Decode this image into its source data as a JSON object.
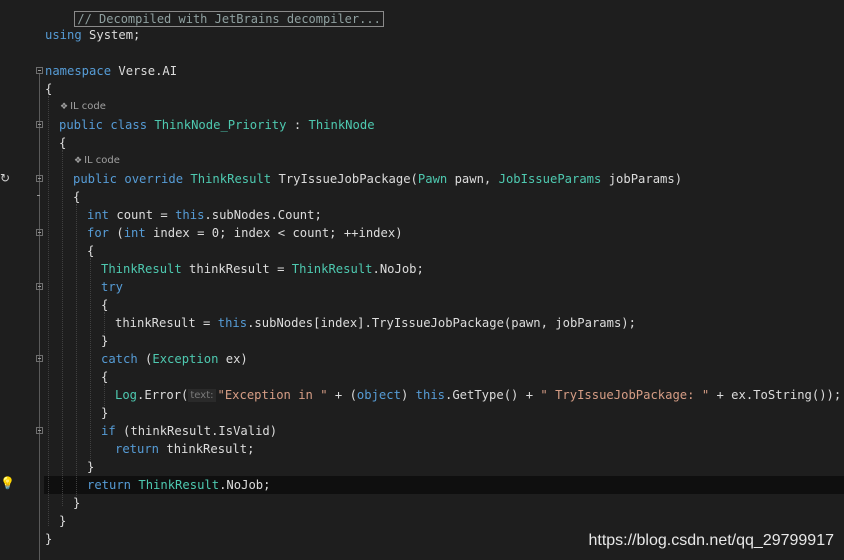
{
  "code": {
    "collapsed_region": "// Decompiled with JetBrains decompiler...",
    "il_code": "IL code",
    "param_hint": "text:",
    "lines": {
      "using": [
        "using",
        " System;"
      ],
      "ns": [
        "namespace",
        " Verse.AI"
      ],
      "open1": "{",
      "cls": [
        "public",
        "class",
        "ThinkNode_Priority",
        " : ",
        "ThinkNode"
      ],
      "open2": "{",
      "method": [
        "public",
        "override",
        "ThinkResult",
        " TryIssueJobPackage(",
        "Pawn",
        " pawn, ",
        "JobIssueParams",
        " jobParams)"
      ],
      "open3": "{",
      "count": [
        "int",
        " count = ",
        "this",
        ".subNodes.Count;"
      ],
      "for": [
        "for",
        " (",
        "int",
        " index = 0; index < count; ++index)"
      ],
      "open4": "{",
      "tr": [
        "ThinkResult",
        " thinkResult = ",
        "ThinkResult",
        ".NoJob;"
      ],
      "try": "try",
      "open5": "{",
      "assign": [
        "thinkResult = ",
        "this",
        ".subNodes[index].TryIssueJobPackage(pawn, jobParams);"
      ],
      "close5": "}",
      "catch": [
        "catch",
        " (",
        "Exception",
        " ex)"
      ],
      "open6": "{",
      "log": [
        "Log",
        ".Error(",
        "\"Exception in \"",
        " + (",
        "object",
        ") ",
        "this",
        ".GetType() + ",
        "\" TryIssueJobPackage: \"",
        " + ex.ToString());"
      ],
      "close6": "}",
      "if": [
        "if",
        " (thinkResult.IsValid)"
      ],
      "ret1": [
        "return",
        " thinkResult;"
      ],
      "close4": "}",
      "ret2": [
        "return",
        " ",
        "ThinkResult",
        ".NoJob;"
      ],
      "close3": "}",
      "close2": "}",
      "close1": "}"
    }
  },
  "watermark": "https://blog.csdn.net/qq_29799917",
  "icons": {
    "breakpoint_marker": "refresh-icon",
    "lightbulb": "lightbulb-icon"
  }
}
